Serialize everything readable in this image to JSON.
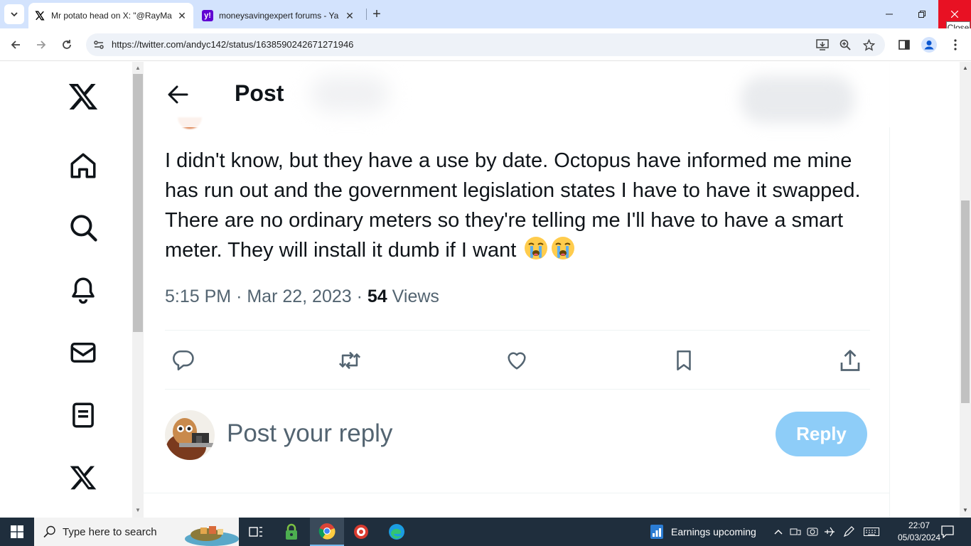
{
  "browser": {
    "tabs": [
      {
        "title": "Mr potato head on X: \"@RayMa",
        "favicon": "x-logo-icon",
        "active": true
      },
      {
        "title": "moneysavingexpert forums - Ya",
        "favicon": "yahoo-icon",
        "active": false
      }
    ],
    "url": "https://twitter.com/andyc142/status/1638590242671271946",
    "close_tooltip": "Close"
  },
  "post": {
    "header_title": "Post",
    "text": "I didn't know, but they have a use by date. Octopus have informed me mine has run out and the government legislation states I have to have it swapped. There are no ordinary meters so they're telling me I'll have to have a smart meter. They will install it dumb if I want",
    "emojis": [
      "loudly-crying-face-icon",
      "loudly-crying-face-icon"
    ],
    "time": "5:15 PM",
    "date": "Mar 22, 2023",
    "separator": "·",
    "views_count": "54",
    "views_label": "Views"
  },
  "reply": {
    "placeholder": "Post your reply",
    "button_label": "Reply"
  },
  "taskbar": {
    "search_placeholder": "Type here to search",
    "widget_label": "Earnings upcoming",
    "time": "22:07",
    "date": "05/03/2024"
  },
  "colors": {
    "tabstrip": "#d3e3fd",
    "reply_button": "#8ecdf8",
    "text_primary": "#0f1419",
    "text_secondary": "#536471",
    "taskbar": "#1f2e3d",
    "close_hover": "#e81123"
  }
}
